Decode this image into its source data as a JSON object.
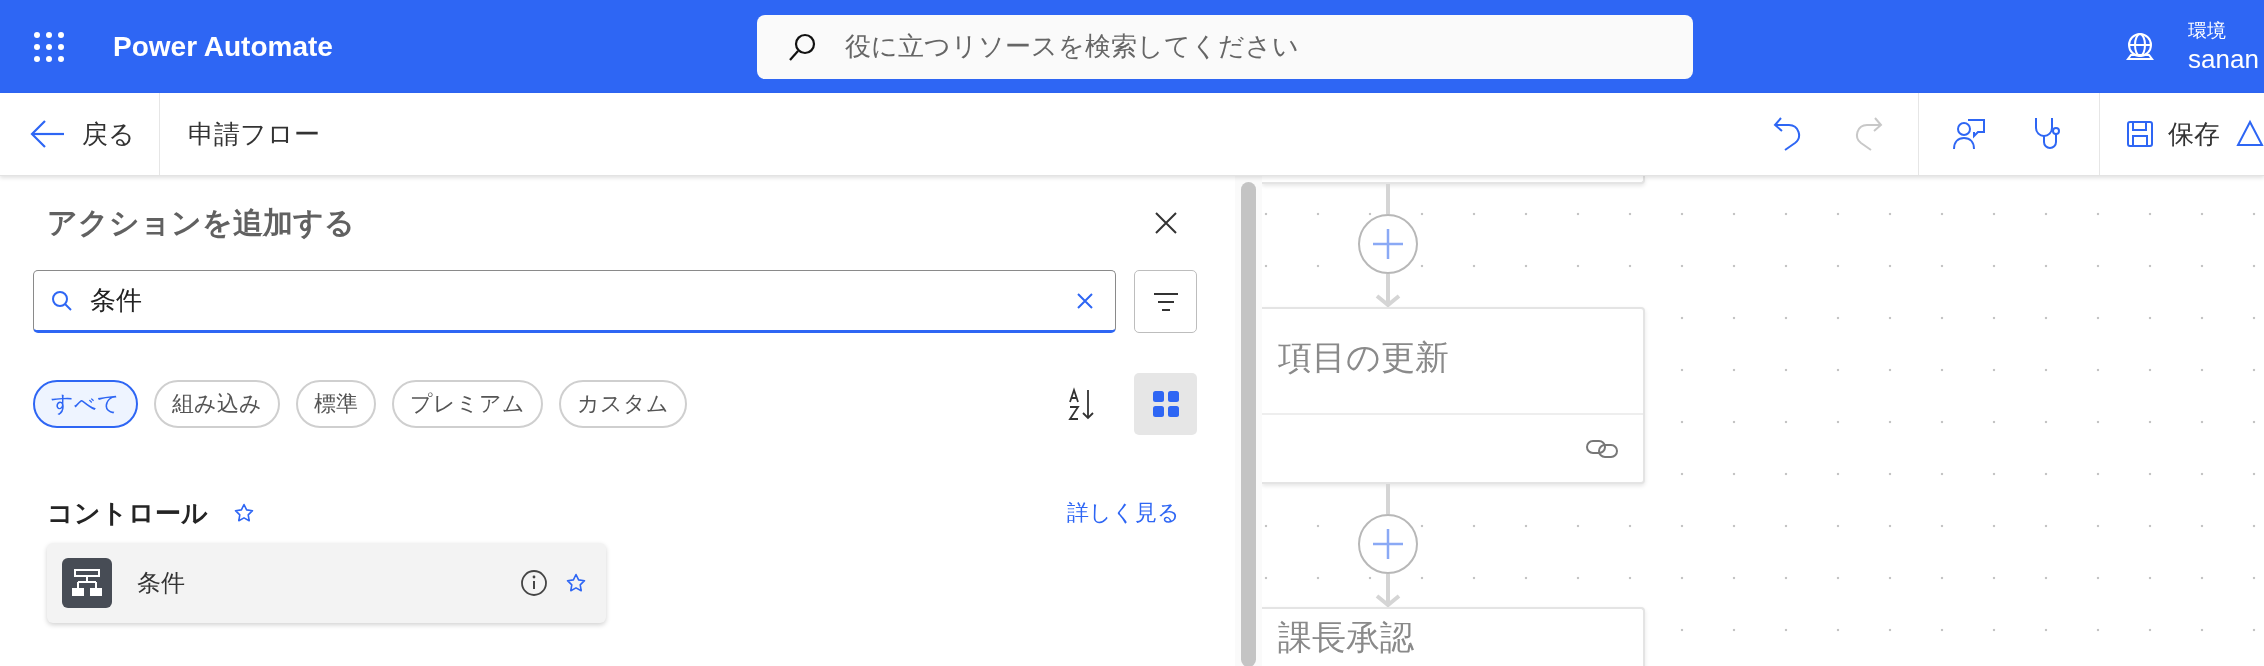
{
  "header": {
    "app_title": "Power Automate",
    "search": {
      "placeholder": "役に立つリソースを検索してください"
    },
    "environment": {
      "label": "環境",
      "name": "sanan"
    }
  },
  "toolbar": {
    "back": "戻る",
    "flow_name": "申請フロー",
    "undo": {
      "disabled": false
    },
    "redo": {
      "disabled": true
    },
    "save": "保存"
  },
  "panel": {
    "title": "アクションを追加する",
    "search": {
      "value": "条件"
    },
    "filters": [
      {
        "label": "すべて",
        "selected": true
      },
      {
        "label": "組み込み",
        "selected": false
      },
      {
        "label": "標準",
        "selected": false
      },
      {
        "label": "プレミアム",
        "selected": false
      },
      {
        "label": "カスタム",
        "selected": false
      }
    ],
    "sections": [
      {
        "title": "コントロール",
        "link": "詳しく見る",
        "actions": [
          {
            "name": "条件"
          }
        ]
      }
    ]
  },
  "canvas": {
    "steps": [
      {
        "title": "項目の更新",
        "kind": "linked"
      },
      {
        "title": "課長承認",
        "kind": "plain"
      }
    ]
  }
}
